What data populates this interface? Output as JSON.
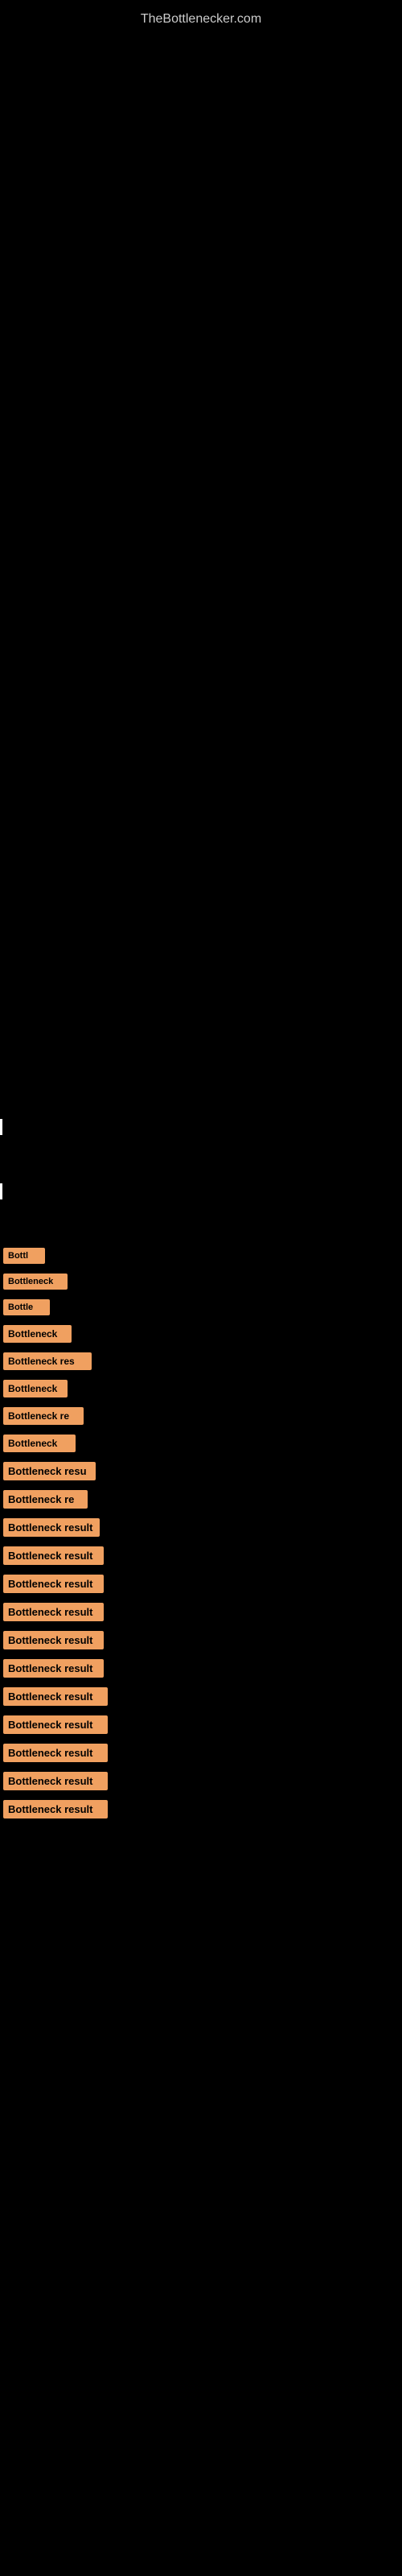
{
  "site": {
    "title": "TheBottlenecker.com"
  },
  "results": [
    {
      "id": 1,
      "label": "Bottl",
      "css_class": "item-1"
    },
    {
      "id": 2,
      "label": "Bottleneck",
      "css_class": "item-2"
    },
    {
      "id": 3,
      "label": "Bottle",
      "css_class": "item-3"
    },
    {
      "id": 4,
      "label": "Bottleneck",
      "css_class": "item-4"
    },
    {
      "id": 5,
      "label": "Bottleneck res",
      "css_class": "item-5"
    },
    {
      "id": 6,
      "label": "Bottleneck",
      "css_class": "item-6"
    },
    {
      "id": 7,
      "label": "Bottleneck re",
      "css_class": "item-7"
    },
    {
      "id": 8,
      "label": "Bottleneck",
      "css_class": "item-8"
    },
    {
      "id": 9,
      "label": "Bottleneck resu",
      "css_class": "item-9"
    },
    {
      "id": 10,
      "label": "Bottleneck re",
      "css_class": "item-10"
    },
    {
      "id": 11,
      "label": "Bottleneck result",
      "css_class": "item-11"
    },
    {
      "id": 12,
      "label": "Bottleneck result",
      "css_class": "item-12"
    },
    {
      "id": 13,
      "label": "Bottleneck result",
      "css_class": "item-13"
    },
    {
      "id": 14,
      "label": "Bottleneck result",
      "css_class": "item-14"
    },
    {
      "id": 15,
      "label": "Bottleneck result",
      "css_class": "item-15"
    },
    {
      "id": 16,
      "label": "Bottleneck result",
      "css_class": "item-16"
    },
    {
      "id": 17,
      "label": "Bottleneck result",
      "css_class": "item-17"
    },
    {
      "id": 18,
      "label": "Bottleneck result",
      "css_class": "item-18"
    },
    {
      "id": 19,
      "label": "Bottleneck result",
      "css_class": "item-19"
    },
    {
      "id": 20,
      "label": "Bottleneck result",
      "css_class": "item-20"
    },
    {
      "id": 21,
      "label": "Bottleneck result",
      "css_class": "item-21"
    }
  ]
}
